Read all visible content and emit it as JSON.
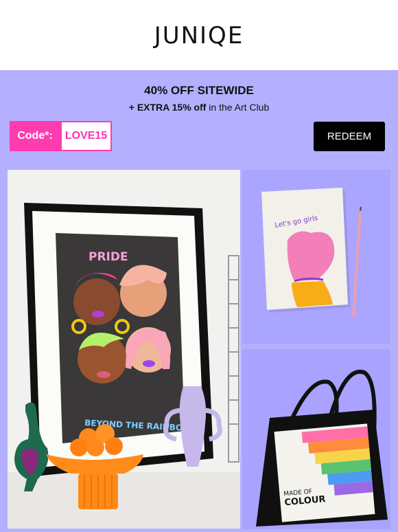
{
  "brand": {
    "logo_text": "JUNIQE"
  },
  "promo": {
    "headline": "40% OFF SITEWIDE",
    "sub_bold": "+ EXTRA 15% off",
    "sub_rest": " in the Art Club",
    "code_label": "Code*:",
    "code_value": "LOVE15",
    "redeem_label": "REDEEM"
  },
  "art": {
    "poster_top_text": "PRIDE",
    "poster_bottom_text": "BEYOND THE RAINBOW",
    "notebook_text": "Let's go girls",
    "bag_title_line1": "MADE OF",
    "bag_title_line2": "COLOUR"
  },
  "colors": {
    "promo_bg": "#b4b0ff",
    "code_pink": "#ff3bb0",
    "button_black": "#000000"
  }
}
